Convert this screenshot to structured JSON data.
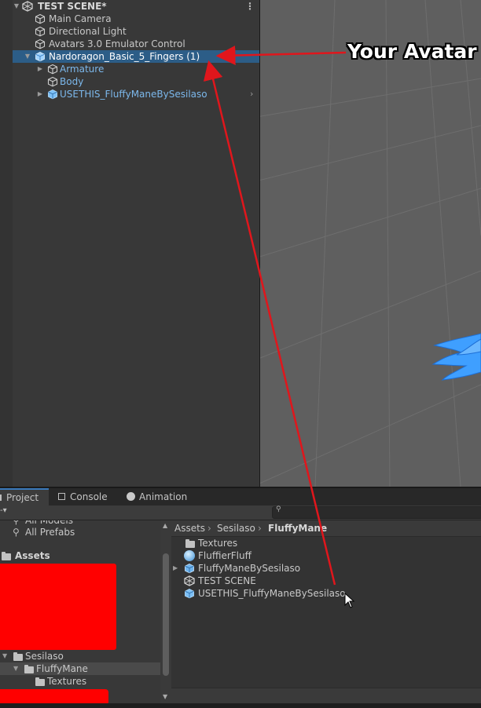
{
  "hierarchy": {
    "scene_name": "TEST SCENE*",
    "items": [
      {
        "label": "Main Camera"
      },
      {
        "label": "Directional Light"
      },
      {
        "label": "Avatars 3.0 Emulator Control"
      },
      {
        "label": "Nardoragon_Basic_5_Fingers (1)"
      },
      {
        "label": "Armature"
      },
      {
        "label": "Body"
      },
      {
        "label": "USETHIS_FluffyManeBySesilaso"
      }
    ]
  },
  "annotation": {
    "callout": "Your Avatar",
    "arrow_color": "#e0161c"
  },
  "tabs": [
    {
      "label": "Project"
    },
    {
      "label": "Console"
    },
    {
      "label": "Animation"
    }
  ],
  "project": {
    "tree": {
      "all_models": "All Models",
      "all_prefabs": "All Prefabs",
      "assets": "Assets",
      "sesilaso": "Sesilaso",
      "fluffymane": "FluffyMane",
      "textures": "Textures"
    },
    "breadcrumb": [
      "Assets",
      "Sesilaso",
      "FluffyMane"
    ],
    "assets": [
      {
        "label": "Textures",
        "icon": "folder-icon"
      },
      {
        "label": "FluffierFluff",
        "icon": "material-icon"
      },
      {
        "label": "FluffyManeBySesilaso",
        "icon": "model-icon"
      },
      {
        "label": "TEST SCENE",
        "icon": "unity-scene-icon"
      },
      {
        "label": "USETHIS_FluffyManeBySesilaso",
        "icon": "prefab-icon"
      }
    ]
  },
  "colors": {
    "selection": "#2c5d87",
    "prefab_text": "#7cb8ec",
    "redaction": "#ff0000",
    "scene_bg": "#5f5f5f"
  }
}
